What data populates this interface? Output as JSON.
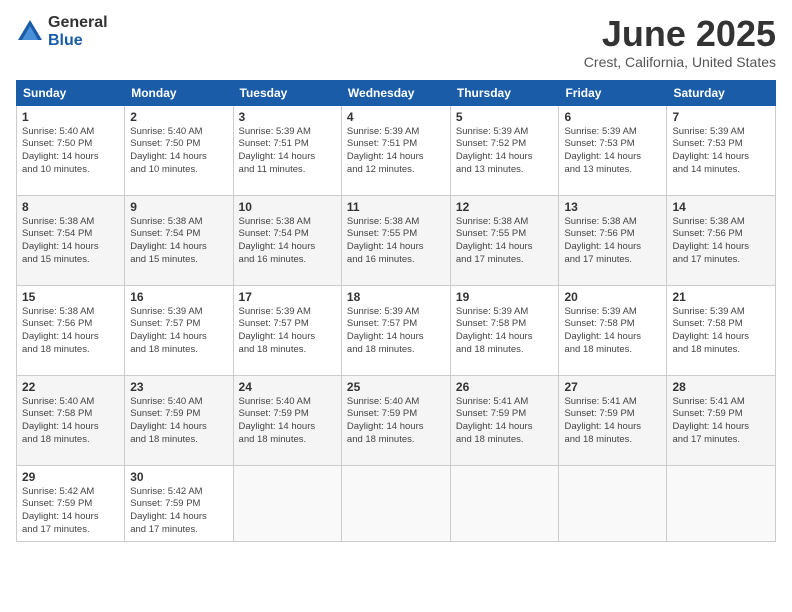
{
  "header": {
    "logo_general": "General",
    "logo_blue": "Blue",
    "title": "June 2025",
    "location": "Crest, California, United States"
  },
  "calendar": {
    "days_of_week": [
      "Sunday",
      "Monday",
      "Tuesday",
      "Wednesday",
      "Thursday",
      "Friday",
      "Saturday"
    ],
    "weeks": [
      [
        {
          "day": "1",
          "info": "Sunrise: 5:40 AM\nSunset: 7:50 PM\nDaylight: 14 hours\nand 10 minutes."
        },
        {
          "day": "2",
          "info": "Sunrise: 5:40 AM\nSunset: 7:50 PM\nDaylight: 14 hours\nand 10 minutes."
        },
        {
          "day": "3",
          "info": "Sunrise: 5:39 AM\nSunset: 7:51 PM\nDaylight: 14 hours\nand 11 minutes."
        },
        {
          "day": "4",
          "info": "Sunrise: 5:39 AM\nSunset: 7:51 PM\nDaylight: 14 hours\nand 12 minutes."
        },
        {
          "day": "5",
          "info": "Sunrise: 5:39 AM\nSunset: 7:52 PM\nDaylight: 14 hours\nand 13 minutes."
        },
        {
          "day": "6",
          "info": "Sunrise: 5:39 AM\nSunset: 7:53 PM\nDaylight: 14 hours\nand 13 minutes."
        },
        {
          "day": "7",
          "info": "Sunrise: 5:39 AM\nSunset: 7:53 PM\nDaylight: 14 hours\nand 14 minutes."
        }
      ],
      [
        {
          "day": "8",
          "info": "Sunrise: 5:38 AM\nSunset: 7:54 PM\nDaylight: 14 hours\nand 15 minutes."
        },
        {
          "day": "9",
          "info": "Sunrise: 5:38 AM\nSunset: 7:54 PM\nDaylight: 14 hours\nand 15 minutes."
        },
        {
          "day": "10",
          "info": "Sunrise: 5:38 AM\nSunset: 7:54 PM\nDaylight: 14 hours\nand 16 minutes."
        },
        {
          "day": "11",
          "info": "Sunrise: 5:38 AM\nSunset: 7:55 PM\nDaylight: 14 hours\nand 16 minutes."
        },
        {
          "day": "12",
          "info": "Sunrise: 5:38 AM\nSunset: 7:55 PM\nDaylight: 14 hours\nand 17 minutes."
        },
        {
          "day": "13",
          "info": "Sunrise: 5:38 AM\nSunset: 7:56 PM\nDaylight: 14 hours\nand 17 minutes."
        },
        {
          "day": "14",
          "info": "Sunrise: 5:38 AM\nSunset: 7:56 PM\nDaylight: 14 hours\nand 17 minutes."
        }
      ],
      [
        {
          "day": "15",
          "info": "Sunrise: 5:38 AM\nSunset: 7:56 PM\nDaylight: 14 hours\nand 18 minutes."
        },
        {
          "day": "16",
          "info": "Sunrise: 5:39 AM\nSunset: 7:57 PM\nDaylight: 14 hours\nand 18 minutes."
        },
        {
          "day": "17",
          "info": "Sunrise: 5:39 AM\nSunset: 7:57 PM\nDaylight: 14 hours\nand 18 minutes."
        },
        {
          "day": "18",
          "info": "Sunrise: 5:39 AM\nSunset: 7:57 PM\nDaylight: 14 hours\nand 18 minutes."
        },
        {
          "day": "19",
          "info": "Sunrise: 5:39 AM\nSunset: 7:58 PM\nDaylight: 14 hours\nand 18 minutes."
        },
        {
          "day": "20",
          "info": "Sunrise: 5:39 AM\nSunset: 7:58 PM\nDaylight: 14 hours\nand 18 minutes."
        },
        {
          "day": "21",
          "info": "Sunrise: 5:39 AM\nSunset: 7:58 PM\nDaylight: 14 hours\nand 18 minutes."
        }
      ],
      [
        {
          "day": "22",
          "info": "Sunrise: 5:40 AM\nSunset: 7:58 PM\nDaylight: 14 hours\nand 18 minutes."
        },
        {
          "day": "23",
          "info": "Sunrise: 5:40 AM\nSunset: 7:59 PM\nDaylight: 14 hours\nand 18 minutes."
        },
        {
          "day": "24",
          "info": "Sunrise: 5:40 AM\nSunset: 7:59 PM\nDaylight: 14 hours\nand 18 minutes."
        },
        {
          "day": "25",
          "info": "Sunrise: 5:40 AM\nSunset: 7:59 PM\nDaylight: 14 hours\nand 18 minutes."
        },
        {
          "day": "26",
          "info": "Sunrise: 5:41 AM\nSunset: 7:59 PM\nDaylight: 14 hours\nand 18 minutes."
        },
        {
          "day": "27",
          "info": "Sunrise: 5:41 AM\nSunset: 7:59 PM\nDaylight: 14 hours\nand 18 minutes."
        },
        {
          "day": "28",
          "info": "Sunrise: 5:41 AM\nSunset: 7:59 PM\nDaylight: 14 hours\nand 17 minutes."
        }
      ],
      [
        {
          "day": "29",
          "info": "Sunrise: 5:42 AM\nSunset: 7:59 PM\nDaylight: 14 hours\nand 17 minutes."
        },
        {
          "day": "30",
          "info": "Sunrise: 5:42 AM\nSunset: 7:59 PM\nDaylight: 14 hours\nand 17 minutes."
        },
        {
          "day": "",
          "info": ""
        },
        {
          "day": "",
          "info": ""
        },
        {
          "day": "",
          "info": ""
        },
        {
          "day": "",
          "info": ""
        },
        {
          "day": "",
          "info": ""
        }
      ]
    ]
  }
}
